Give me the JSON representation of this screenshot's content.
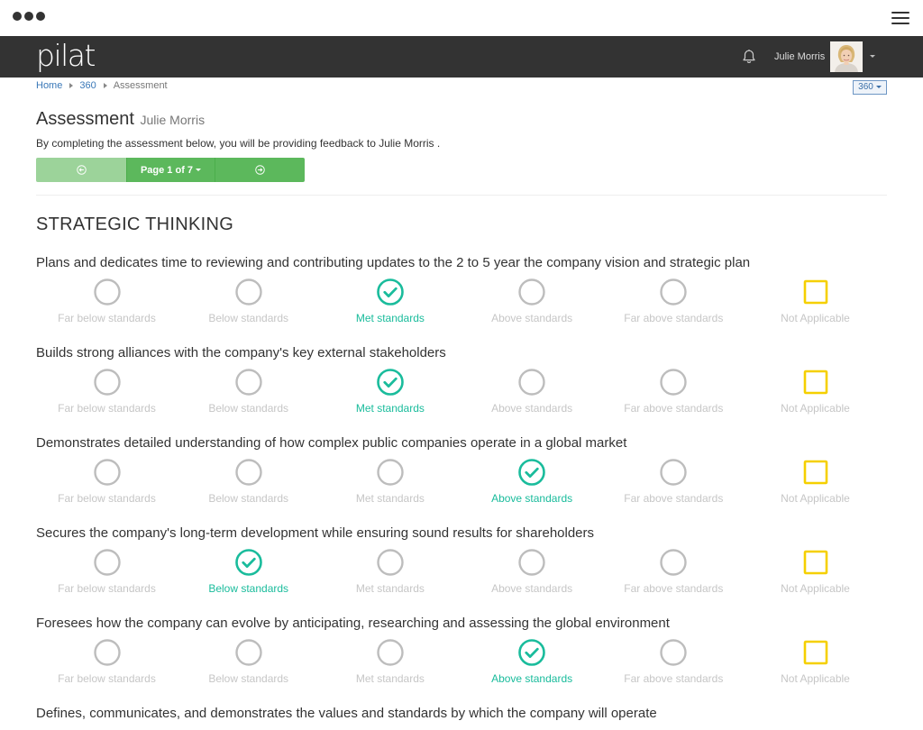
{
  "header": {
    "logo": "pilat",
    "user_name": "Julie Morris"
  },
  "breadcrumb": {
    "items": [
      "Home",
      "360"
    ],
    "current": "Assessment"
  },
  "module_menu": {
    "label": "360"
  },
  "page": {
    "title": "Assessment",
    "subject": "Julie Morris",
    "intro": "By completing the assessment below, you will be providing feedback to Julie Morris ."
  },
  "pager": {
    "label": "Page 1 of 7"
  },
  "section": {
    "title": "STRATEGIC THINKING"
  },
  "rating_labels": [
    "Far below standards",
    "Below standards",
    "Met standards",
    "Above standards",
    "Far above standards",
    "Not Applicable"
  ],
  "questions": [
    {
      "text": "Plans and dedicates time to reviewing and contributing updates to the 2 to 5 year the company vision and strategic plan",
      "selected_label": "Met standards"
    },
    {
      "text": "Builds strong alliances with the company's key external stakeholders",
      "selected_label": "Met standards"
    },
    {
      "text": "Demonstrates detailed understanding of how complex public companies operate in a global market",
      "selected_label": "Above standards"
    },
    {
      "text": "Secures the company's long-term development while ensuring sound results for shareholders",
      "selected_label": "Below standards"
    },
    {
      "text": "Foresees how the company can evolve by anticipating, researching and assessing the global environment",
      "selected_label": "Above standards"
    },
    {
      "text": "Defines, communicates, and demonstrates the values and standards by which the company will operate",
      "selected_label": ""
    }
  ],
  "colors": {
    "header_bg": "#333333",
    "pager_green": "#5cb85c",
    "pager_green_light": "#9cd39a",
    "selected_teal": "#1abc9c",
    "unselected_grey": "#bdbdbd",
    "na_yellow": "#f5d000",
    "link_blue": "#3a78b8"
  },
  "icons": {
    "notifications": "bell-icon",
    "previous_page": "circle-arrow-left-icon",
    "next_page": "circle-arrow-right-icon",
    "selected_option": "check-circle-icon",
    "unselected_option": "empty-circle-icon",
    "not_applicable": "empty-square-icon"
  }
}
